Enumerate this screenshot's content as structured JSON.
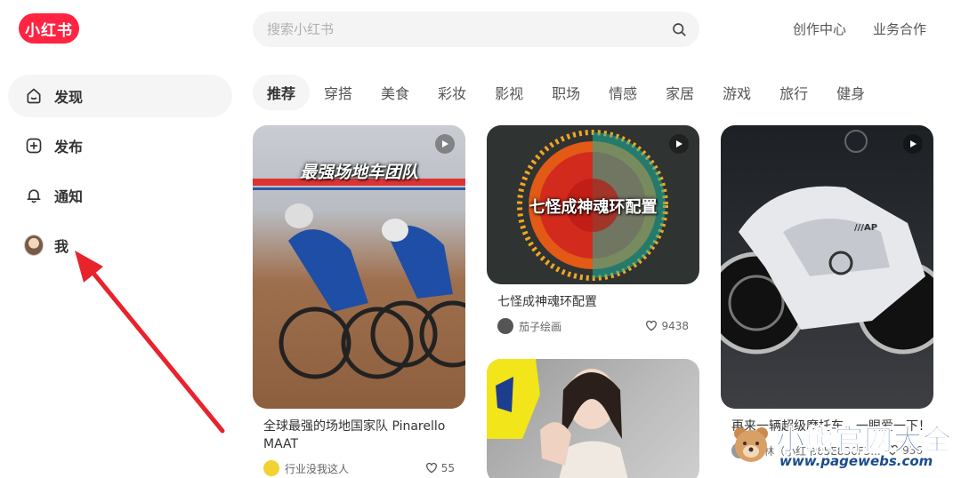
{
  "brand": {
    "logo_text": "小红书",
    "color": "#ff2442"
  },
  "search": {
    "placeholder": "搜索小红书",
    "icon": "search-icon"
  },
  "top_links": [
    "创作中心",
    "业务合作"
  ],
  "sidebar": {
    "items": [
      {
        "label": "发现",
        "icon": "home-icon",
        "active": true
      },
      {
        "label": "发布",
        "icon": "plus-square-icon",
        "active": false
      },
      {
        "label": "通知",
        "icon": "bell-icon",
        "active": false
      },
      {
        "label": "我",
        "icon": "avatar",
        "active": false
      }
    ]
  },
  "channels": [
    "推荐",
    "穿搭",
    "美食",
    "彩妆",
    "影视",
    "职场",
    "情感",
    "家居",
    "游戏",
    "旅行",
    "健身"
  ],
  "feed": [
    {
      "title": "全球最强的场地国家队 Pinarello MAAT",
      "image_text": "最强场地车团队",
      "author": "行业没我这人",
      "likes": "55",
      "video": true
    },
    {
      "title": "七怪成神魂环配置",
      "image_text": "七怪成神魂环配置",
      "author": "茄子绘画",
      "likes": "9438",
      "video": true
    },
    {
      "title": "",
      "image_text": "",
      "author": "",
      "likes": "",
      "video": false
    },
    {
      "title": "再来一辆超级摩托车，一眼爱一下！",
      "image_text": "",
      "author": "摩林（小红书65E836F3...",
      "likes": "936",
      "video": true
    }
  ],
  "watermark": {
    "text": "小熊官网大全",
    "url": "www.pagewebs.com"
  }
}
